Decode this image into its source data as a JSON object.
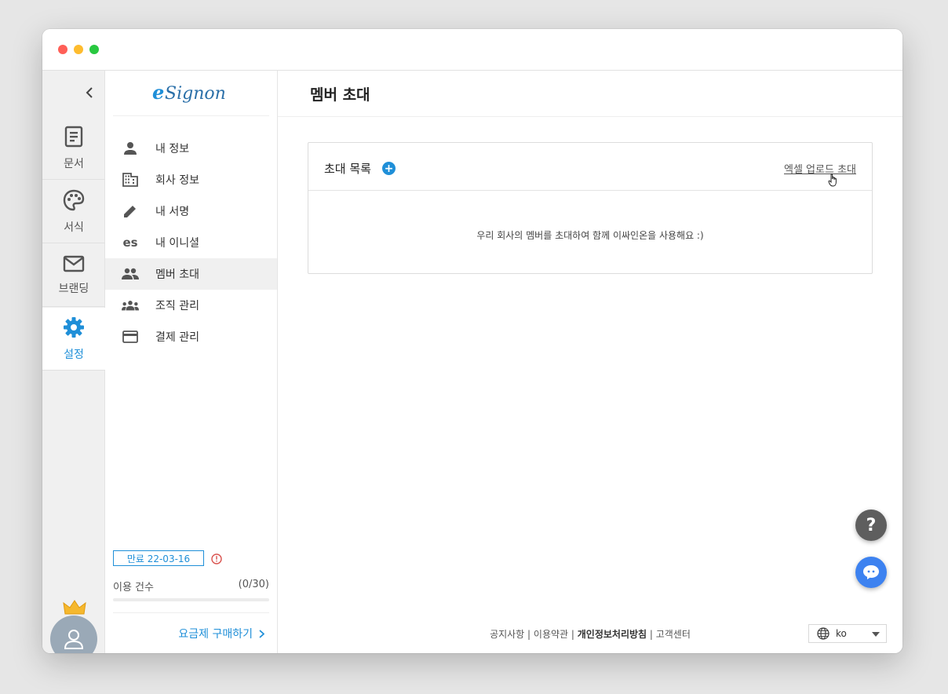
{
  "window": {
    "controls": [
      "close",
      "minimize",
      "maximize"
    ]
  },
  "rail": {
    "collapse_icon": "chevron-left-icon",
    "items": [
      {
        "label": "문서",
        "icon": "document-icon"
      },
      {
        "label": "서식",
        "icon": "palette-icon"
      },
      {
        "label": "브랜딩",
        "icon": "mail-icon"
      },
      {
        "label": "설정",
        "icon": "gear-icon",
        "active": true
      }
    ],
    "avatar_icon": "user-avatar-icon",
    "crown_icon": "crown-icon"
  },
  "menu": {
    "logo_text": "eSignon",
    "items": [
      {
        "label": "내 정보",
        "icon": "person-icon"
      },
      {
        "label": "회사 정보",
        "icon": "building-icon"
      },
      {
        "label": "내 서명",
        "icon": "pencil-icon"
      },
      {
        "label": "내 이니셜",
        "icon_text": "es"
      },
      {
        "label": "멤버 초대",
        "icon": "people-icon",
        "active": true
      },
      {
        "label": "조직 관리",
        "icon": "group-icon"
      },
      {
        "label": "결제 관리",
        "icon": "credit-card-icon"
      }
    ],
    "expiry_label": "만료 22-03-16",
    "usage_label": "이용 건수",
    "usage_value": "(0/30)",
    "usage_fraction": 0,
    "buy_label": "요금제 구매하기"
  },
  "main": {
    "title": "멤버 초대",
    "card": {
      "title": "초대 목록",
      "add_symbol": "+",
      "excel_link": "엑셀 업로드 초대",
      "empty_message": "우리 회사의 멤버를 초대하여 함께 이싸인온을 사용해요 :)"
    },
    "help_symbol": "?",
    "footer": {
      "notice": "공지사항",
      "terms": "이용약관",
      "privacy": "개인정보처리방침",
      "support": "고객센터",
      "separator": " | "
    },
    "language": "ko"
  },
  "colors": {
    "accent": "#1f8fd8",
    "help_button": "#5e5e5e",
    "chat_button": "#3d82f0"
  }
}
